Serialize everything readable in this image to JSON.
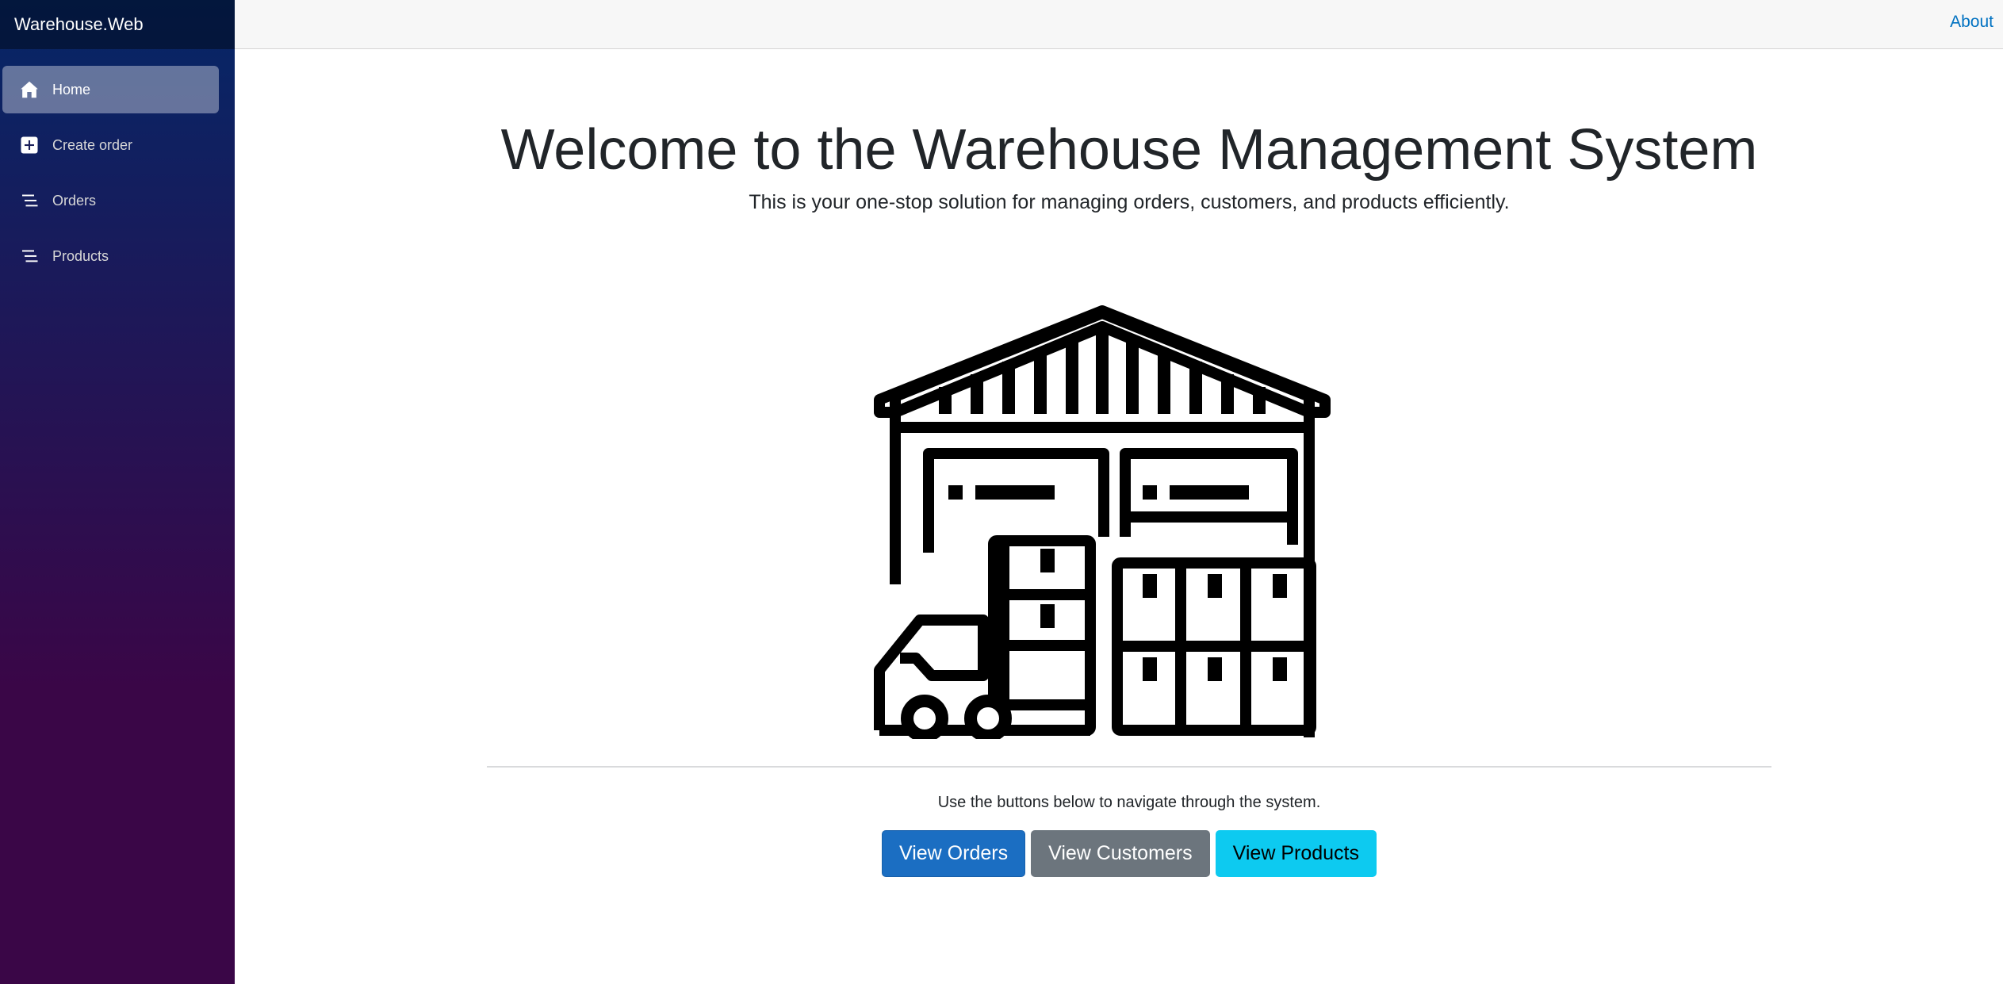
{
  "app": {
    "brand": "Warehouse.Web"
  },
  "sidebar": {
    "items": [
      {
        "label": "Home",
        "icon": "home-icon",
        "active": true
      },
      {
        "label": "Create order",
        "icon": "plus-square-icon",
        "active": false
      },
      {
        "label": "Orders",
        "icon": "list-icon",
        "active": false
      },
      {
        "label": "Products",
        "icon": "list-icon",
        "active": false
      }
    ]
  },
  "topbar": {
    "about_label": "About"
  },
  "main": {
    "title": "Welcome to the Warehouse Management System",
    "subtitle": "This is your one-stop solution for managing orders, customers, and products efficiently.",
    "hero_icon": "warehouse-icon",
    "hint": "Use the buttons below to navigate through the system.",
    "buttons": {
      "orders_label": "View Orders",
      "customers_label": "View Customers",
      "products_label": "View Products"
    }
  },
  "colors": {
    "sidebar_gradient_top": "#052767",
    "sidebar_gradient_bottom": "#3a0647",
    "link": "#0071c1",
    "btn_primary": "#1b6ec2",
    "btn_secondary": "#6c757d",
    "btn_info": "#0dcaf0"
  }
}
